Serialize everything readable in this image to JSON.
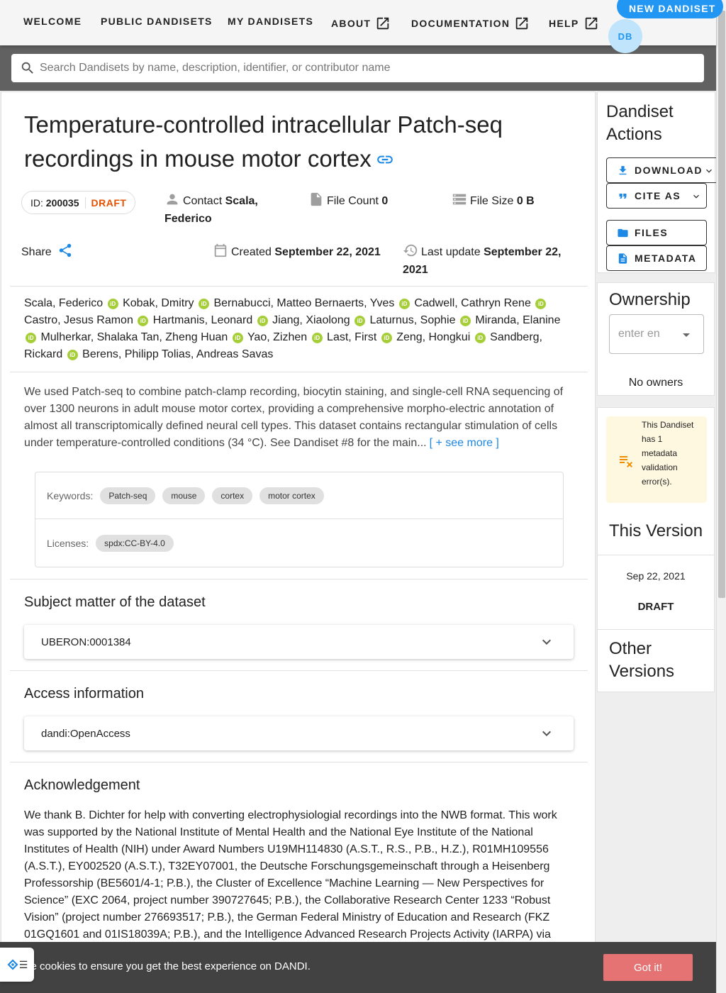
{
  "nav": {
    "welcome": "WELCOME",
    "public": "PUBLIC DANDISETS",
    "my": "MY DANDISETS",
    "about": "ABOUT",
    "docs": "DOCUMENTATION",
    "help": "HELP",
    "new_dandiset": "NEW DANDISET",
    "avatar_initials": "DB"
  },
  "search": {
    "placeholder": "Search Dandisets by name, description, identifier, or contributor name"
  },
  "dandiset": {
    "title": "Temperature-controlled intracellular Patch-seq recordings in mouse motor cortex",
    "id_label": "ID:",
    "id": "200035",
    "status": "DRAFT",
    "contact_label": "Contact",
    "contact": "Scala, Federico",
    "file_count_label": "File Count",
    "file_count": "0",
    "file_size_label": "File Size",
    "file_size": "0 B",
    "share_label": "Share",
    "created_label": "Created",
    "created": "September 22, 2021",
    "updated_label": "Last update",
    "updated": "September 22, 2021",
    "contributors": [
      "Scala, Federico",
      "Kobak, Dmitry",
      "Bernabucci, Matteo",
      "Bernaerts, Yves",
      "Cadwell, Cathryn Rene",
      "Castro, Jesus Ramon",
      "Hartmanis, Leonard",
      "Jiang, Xiaolong",
      "Laturnus, Sophie",
      "Miranda, Elanine",
      "Mulherkar, Shalaka",
      "Tan, Zheng Huan",
      "Yao, Zizhen",
      "Last, First",
      "Zeng, Hongkui",
      "Sandberg, Rickard",
      "Berens, Philipp",
      "Tolias, Andreas Savas"
    ],
    "description": "We used Patch-seq to combine patch-clamp recording, biocytin staining, and single-cell RNA sequencing of over 1300 neurons in adult mouse motor cortex, providing a comprehensive morpho-electric annotation of almost all transcriptomically defined neural cell types. This dataset contains rectangular stimulation of cells under temperature-controlled conditions (34 °C). See Dandiset #8 for the main...",
    "see_more": "[ + see more ]",
    "keywords_label": "Keywords:",
    "keywords": [
      "Patch-seq",
      "mouse",
      "cortex",
      "motor cortex"
    ],
    "licenses_label": "Licenses:",
    "licenses": [
      "spdx:CC-BY-4.0"
    ],
    "subject_heading": "Subject matter of the dataset",
    "subject_value": "UBERON:0001384",
    "access_heading": "Access information",
    "access_value": "dandi:OpenAccess",
    "ack_heading": "Acknowledgement",
    "ack_text": "We thank B. Dichter for help with converting electrophysiologial recordings into the NWB format. This work was supported by the National Institute of Mental Health and the National Eye Institute of the National Institutes of Health (NIH) under Award Numbers U19MH114830 (A.S.T., R.S., P.B., H.Z.), R01MH109556 (A.S.T.), EY002520 (A.S.T.), T32EY07001, the Deutsche Forschungsgemeinschaft through a Heisenberg Professorship (BE5601/4-1; P.B.), the Cluster of Excellence “Machine Learning — New Perspectives for Science” (EXC 2064, project number 390727645; P.B.), the Collaborative Research Center 1233 “Robust Vision” (project number 276693517; P.B.), the German Federal Ministry of Education and Research (FKZ 01GQ1601 and 01IS18039A; P.B.), and the Intelligence Advanced Research Projects Activity (IARPA) via Department of"
  },
  "sidebar": {
    "actions_heading": "Dandiset Actions",
    "download": "DOWNLOAD",
    "cite": "CITE AS",
    "files": "FILES",
    "metadata": "METADATA",
    "ownership_heading": "Ownership",
    "owner_placeholder": "enter en",
    "no_owners": "No owners",
    "validation_message": "This Dandiset has 1 metadata validation error(s).",
    "this_version_heading": "This Version",
    "version_date": "Sep 22, 2021",
    "version_name": "DRAFT",
    "other_versions_heading": "Other Versions"
  },
  "cookie": {
    "message": "se cookies to ensure you get the best experience on DANDI.",
    "button": "Got it!"
  },
  "colors": {
    "primary": "#2196f3",
    "draft": "#e65100",
    "orcid": "#a6ce39",
    "cookie_button": "#e57373",
    "warning_bg": "#fff8e1"
  }
}
